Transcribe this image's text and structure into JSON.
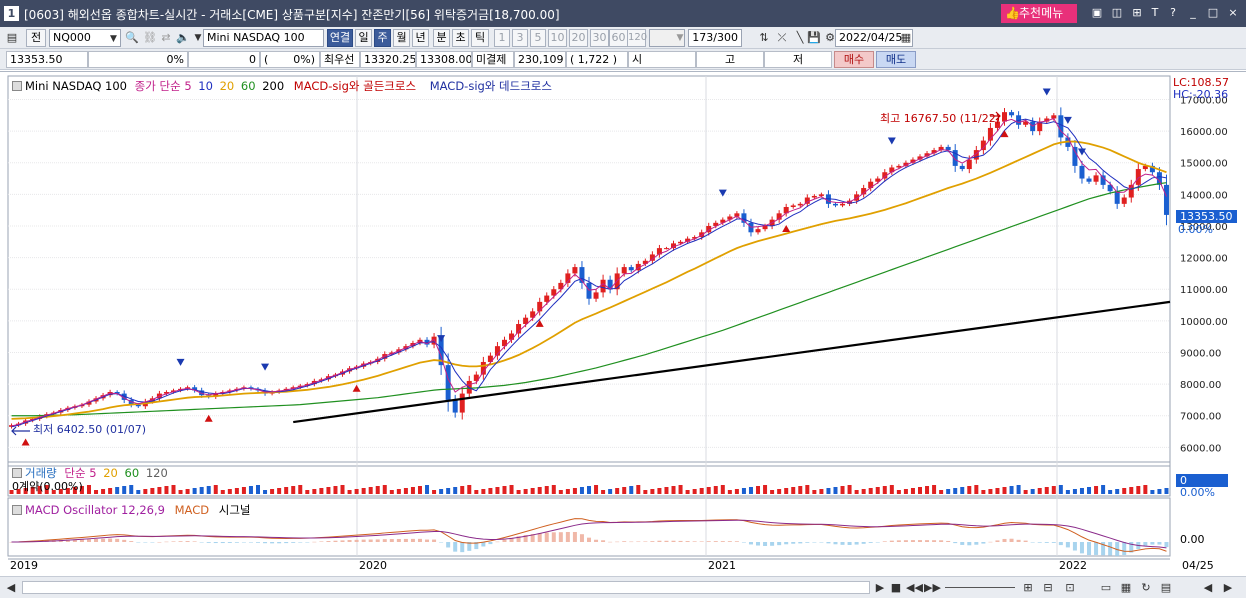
{
  "window": {
    "number": "1",
    "title": "[0603] 해외선옵 종합차트-실시간 - 거래소[CME] 상품구분[지수] 잔존만기[56] 위탁증거금[18,700.00]",
    "recommend_menu": "추천메뉴",
    "controls": [
      "T",
      "?",
      "_",
      "□",
      "×"
    ]
  },
  "toolbar": {
    "type_label": "전",
    "symbol_code": "NQ000",
    "symbol_name": "Mini NASDAQ 100",
    "period_buttons": [
      {
        "label": "연결",
        "active": true
      },
      {
        "label": "일",
        "active": false
      },
      {
        "label": "주",
        "active": true
      },
      {
        "label": "월",
        "active": false
      },
      {
        "label": "년",
        "active": false
      },
      {
        "label": "분",
        "active": false
      },
      {
        "label": "초",
        "active": false
      },
      {
        "label": "틱",
        "active": false
      }
    ],
    "interval_buttons": [
      "1",
      "3",
      "5",
      "10",
      "20",
      "30",
      "60",
      "120"
    ],
    "count_display": "173/300",
    "date": "2022/04/25"
  },
  "quote": {
    "price": "13353.50",
    "change_pct": "0%",
    "change": "0",
    "rate_label": "(",
    "rate": "0%)",
    "best_bid_label": "최우선",
    "best_bid": "13320.25",
    "best_ask": "13308.00",
    "open_interest_label": "미결제",
    "open_interest": "230,109",
    "open_interest_change": "( 1,722 )",
    "open_label": "시",
    "high_label": "고",
    "low_label": "저",
    "buy_label": "매수",
    "sell_label": "매도"
  },
  "main_legend": {
    "symbol": "Mini NASDAQ 100",
    "ma_label": "종가 단순",
    "ma_periods": [
      "5",
      "10",
      "20",
      "60",
      "200"
    ],
    "ma_colors": [
      "#c0208a",
      "#2030c0",
      "#e0a000",
      "#209020",
      "#000000"
    ],
    "signal1": "MACD-sig와 골든크로스",
    "signal2": "MACD-sig와 데드크로스"
  },
  "annotations": {
    "high_marker": "최고 16767.50 (11/22)",
    "low_marker": "최저 6402.50 (01/07)"
  },
  "right_labels": {
    "lc": "LC:108.57",
    "hc": "HC:-20.36",
    "current_price": "13353.50",
    "pct": "0.00%"
  },
  "y_axis": [
    "17000.00",
    "16000.00",
    "15000.00",
    "14000.00",
    "13000.00",
    "12000.00",
    "11000.00",
    "10000.00",
    "9000.00",
    "8000.00",
    "7000.00",
    "6000.00"
  ],
  "volume_legend": {
    "label": "거래량",
    "ma_label": "단순",
    "periods": [
      "5",
      "20",
      "60",
      "120"
    ],
    "period_colors": [
      "#c0208a",
      "#e0a000",
      "#209020",
      "#606060"
    ],
    "oi_text": "0계약(0.00%)",
    "right_value": "0",
    "right_pct": "0.00%"
  },
  "macd_legend": {
    "osc": "MACD Oscillator 12,26,9",
    "macd": "MACD",
    "signal": "시그널",
    "right_value": "0.00"
  },
  "x_axis": [
    "2019",
    "2020",
    "2021",
    "2022",
    "04/25"
  ],
  "colors": {
    "up": "#e02020",
    "down": "#1a5fd0",
    "title_bg": "#3f4a63",
    "toolbar_bg": "#e9ecf1"
  },
  "chart_data": {
    "type": "candlestick",
    "symbol": "Mini NASDAQ 100",
    "period": "weekly",
    "x_range": [
      "2019-01",
      "2022-04-25"
    ],
    "ylim": [
      5600,
      17300
    ],
    "close_series": [
      6700,
      6750,
      6850,
      6900,
      6980,
      7050,
      7100,
      7180,
      7250,
      7300,
      7350,
      7450,
      7550,
      7650,
      7750,
      7700,
      7500,
      7350,
      7300,
      7450,
      7550,
      7700,
      7750,
      7800,
      7850,
      7900,
      7800,
      7650,
      7600,
      7700,
      7750,
      7800,
      7850,
      7900,
      7850,
      7800,
      7700,
      7750,
      7800,
      7850,
      7900,
      7950,
      8000,
      8100,
      8150,
      8250,
      8300,
      8400,
      8500,
      8550,
      8650,
      8700,
      8800,
      8950,
      9000,
      9100,
      9200,
      9300,
      9400,
      9250,
      9500,
      8600,
      7500,
      7100,
      7700,
      8100,
      8300,
      8700,
      8900,
      9200,
      9400,
      9600,
      9900,
      10100,
      10300,
      10600,
      10800,
      11000,
      11200,
      11500,
      11700,
      11200,
      10700,
      10900,
      11300,
      11000,
      11500,
      11700,
      11600,
      11800,
      11900,
      12100,
      12300,
      12300,
      12450,
      12500,
      12600,
      12650,
      12800,
      13000,
      13100,
      13200,
      13300,
      13400,
      13100,
      12800,
      12900,
      13000,
      13200,
      13400,
      13600,
      13650,
      13700,
      13900,
      13950,
      14000,
      13700,
      13650,
      13700,
      13800,
      14000,
      14200,
      14400,
      14500,
      14700,
      14850,
      14900,
      15000,
      15100,
      15200,
      15300,
      15400,
      15500,
      15400,
      14900,
      14800,
      15100,
      15400,
      15700,
      16100,
      16300,
      16600,
      16500,
      16200,
      16300,
      16000,
      16300,
      16400,
      16500,
      15800,
      15500,
      14900,
      14500,
      14400,
      14600,
      14300,
      14100,
      13700,
      13900,
      14300,
      14800,
      14900,
      14700,
      14300,
      13350
    ],
    "ma5": [
      6650,
      6700,
      6780,
      6850,
      6920,
      6990,
      7060,
      7130,
      7200,
      7270,
      7330,
      7420,
      7500,
      7590,
      7680,
      7700,
      7620,
      7530,
      7450,
      7430,
      7460,
      7540,
      7630,
      7720,
      7790,
      7840,
      7820,
      7760,
      7720,
      7700,
      7700,
      7740,
      7800,
      7860,
      7860,
      7840,
      7790,
      7760,
      7760,
      7780,
      7820,
      7880,
      7940,
      8010,
      8090,
      8170,
      8260,
      8340,
      8430,
      8500,
      8580,
      8660,
      8730,
      8830,
      8920,
      9010,
      9100,
      9200,
      9300,
      9310,
      9340,
      9160,
      8820,
      8400,
      8100,
      7880,
      7790,
      8100,
      8460,
      8700,
      8960,
      9200,
      9430,
      9640,
      9840,
      10050,
      10290,
      10530,
      10750,
      11000,
      11250,
      11340,
      11240,
      11100,
      11050,
      11000,
      11040,
      11270,
      11400,
      11550,
      11680,
      11800,
      11950,
      12100,
      12240,
      12340,
      12450,
      12530,
      12620,
      12740,
      12870,
      12990,
      13100,
      13220,
      13220,
      13120,
      13060,
      13020,
      13000,
      13060,
      13220,
      13350,
      13450,
      13620,
      13750,
      13860,
      13860,
      13840,
      13780,
      13720,
      13760,
      13870,
      14030,
      14230,
      14420,
      14580,
      14730,
      14850,
      14950,
      15050,
      15150,
      15230,
      15330,
      15380,
      15300,
      15180,
      15140,
      15180,
      15240,
      15420,
      15700,
      16020,
      16240,
      16340,
      16380,
      16320,
      16270,
      16240,
      16300,
      16200,
      16100,
      15820,
      15460,
      15150,
      14980,
      14760,
      14580,
      14420,
      14240,
      14160,
      14240,
      14380,
      14520,
      14560,
      14520
    ],
    "ma20": [
      6900,
      6910,
      6920,
      6935,
      6950,
      6970,
      6990,
      7010,
      7040,
      7070,
      7100,
      7130,
      7170,
      7210,
      7260,
      7300,
      7330,
      7350,
      7370,
      7390,
      7420,
      7450,
      7480,
      7510,
      7540,
      7570,
      7590,
      7600,
      7610,
      7620,
      7640,
      7660,
      7680,
      7700,
      7710,
      7720,
      7730,
      7740,
      7750,
      7760,
      7780,
      7800,
      7820,
      7850,
      7880,
      7910,
      7950,
      7990,
      8040,
      8090,
      8140,
      8200,
      8260,
      8330,
      8400,
      8470,
      8540,
      8610,
      8680,
      8720,
      8760,
      8740,
      8680,
      8620,
      8580,
      8560,
      8560,
      8580,
      8620,
      8680,
      8750,
      8830,
      8920,
      9030,
      9140,
      9260,
      9390,
      9520,
      9660,
      9800,
      9940,
      10050,
      10140,
      10230,
      10330,
      10420,
      10520,
      10620,
      10720,
      10820,
      10920,
      11020,
      11120,
      11220,
      11330,
      11440,
      11550,
      11650,
      11760,
      11870,
      11980,
      12090,
      12200,
      12300,
      12380,
      12450,
      12520,
      12580,
      12640,
      12700,
      12760,
      12820,
      12880,
      12940,
      13000,
      13060,
      13110,
      13160,
      13200,
      13240,
      13290,
      13340,
      13390,
      13450,
      13510,
      13580,
      13650,
      13720,
      13800,
      13880,
      13960,
      14040,
      14120,
      14200,
      14270,
      14340,
      14420,
      14500,
      14590,
      14680,
      14780,
      14880,
      14980,
      15080,
      15180,
      15280,
      15380,
      15480,
      15580,
      15640,
      15670,
      15670,
      15640,
      15600,
      15540,
      15480,
      15400,
      15300,
      15200,
      15100,
      15000,
      14920,
      14860,
      14780,
      14700
    ],
    "ma60": [
      7000,
      7000,
      7000,
      7000,
      7005,
      7010,
      7015,
      7020,
      7025,
      7030,
      7040,
      7050,
      7060,
      7070,
      7080,
      7090,
      7100,
      7110,
      7120,
      7130,
      7140,
      7150,
      7160,
      7170,
      7180,
      7190,
      7200,
      7210,
      7220,
      7230,
      7240,
      7250,
      7260,
      7270,
      7280,
      7290,
      7300,
      7310,
      7320,
      7330,
      7340,
      7350,
      7370,
      7390,
      7410,
      7430,
      7450,
      7470,
      7490,
      7510,
      7530,
      7550,
      7570,
      7600,
      7630,
      7660,
      7690,
      7720,
      7750,
      7780,
      7810,
      7830,
      7840,
      7850,
      7860,
      7870,
      7880,
      7900,
      7920,
      7940,
      7960,
      7990,
      8020,
      8050,
      8090,
      8130,
      8170,
      8210,
      8260,
      8310,
      8360,
      8410,
      8460,
      8510,
      8570,
      8630,
      8690,
      8750,
      8810,
      8870,
      8930,
      9000,
      9070,
      9140,
      9210,
      9280,
      9350,
      9420,
      9490,
      9560,
      9630,
      9700,
      9780,
      9860,
      9940,
      10020,
      10100,
      10180,
      10260,
      10340,
      10420,
      10500,
      10580,
      10660,
      10740,
      10820,
      10900,
      10980,
      11060,
      11140,
      11220,
      11300,
      11380,
      11460,
      11540,
      11620,
      11700,
      11780,
      11860,
      11940,
      12020,
      12100,
      12180,
      12260,
      12340,
      12420,
      12500,
      12580,
      12660,
      12740,
      12820,
      12900,
      12980,
      13060,
      13140,
      13220,
      13300,
      13380,
      13460,
      13540,
      13620,
      13700,
      13780,
      13860,
      13920,
      13980,
      14040,
      14090,
      14140,
      14180,
      14220,
      14260,
      14300,
      14340,
      14370
    ],
    "ma200_range": {
      "start_value": 6800,
      "end_value": 10600
    }
  }
}
